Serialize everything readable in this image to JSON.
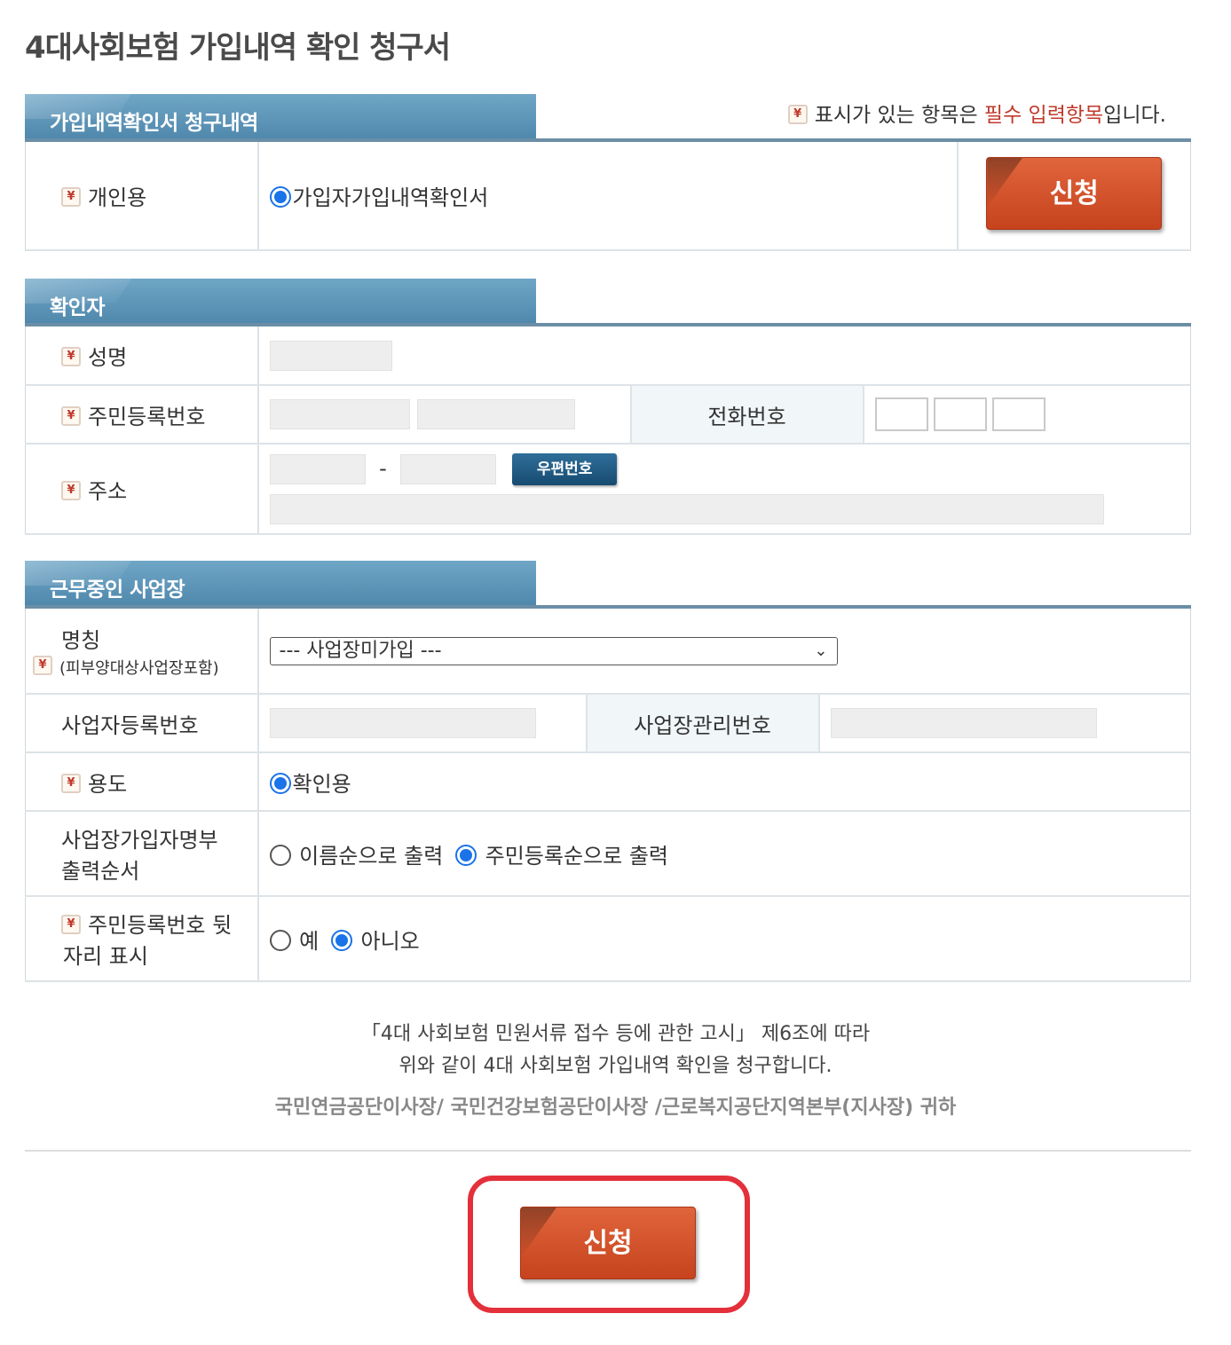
{
  "page_title": "4대사회보험 가입내역 확인 청구서",
  "required_note": {
    "prefix": "표시가 있는 항목은 ",
    "highlight": "필수 입력항목",
    "suffix": "입니다."
  },
  "section1": {
    "title": "가입내역확인서 청구내역",
    "row_label": "개인용",
    "radio_label": "가입자가입내역확인서",
    "apply_button": "신청"
  },
  "section2": {
    "title": "확인자",
    "name_label": "성명",
    "rrn_label": "주민등록번호",
    "phone_label": "전화번호",
    "address_label": "주소",
    "zip_dash": "-",
    "zip_button": "우편번호"
  },
  "section3": {
    "title": "근무중인 사업장",
    "workplace_label": "명칭",
    "workplace_sublabel": "(피부양대상사업장포함)",
    "workplace_select": "--- 사업장미가입 ---",
    "biz_reg_label": "사업자등록번호",
    "biz_mgmt_label": "사업장관리번호",
    "purpose_label": "용도",
    "purpose_option": "확인용",
    "order_label_1": "사업장가입자명부",
    "order_label_2": "출력순서",
    "order_option_1": "이름순으로 출력",
    "order_option_2": "주민등록순으로 출력",
    "rrn_show_label_1": "주민등록번호 뒷",
    "rrn_show_label_2": "자리 표시",
    "yes": "예",
    "no": "아니오"
  },
  "notice": {
    "line1": "「4대 사회보험 민원서류 접수 등에 관한 고시」 제6조에 따라",
    "line2": "위와 같이 4대 사회보험 가입내역 확인을 청구합니다.",
    "line3": "국민연금공단이사장/ 국민건강보험공단이사장 /근로복지공단지역본부(지사장) 귀하"
  },
  "submit_button": "신청",
  "colors": {
    "header_blue": "#5b93b6",
    "apply_orange": "#d4522a",
    "highlight_red": "#e3303b",
    "radio_blue": "#1a73e8"
  }
}
